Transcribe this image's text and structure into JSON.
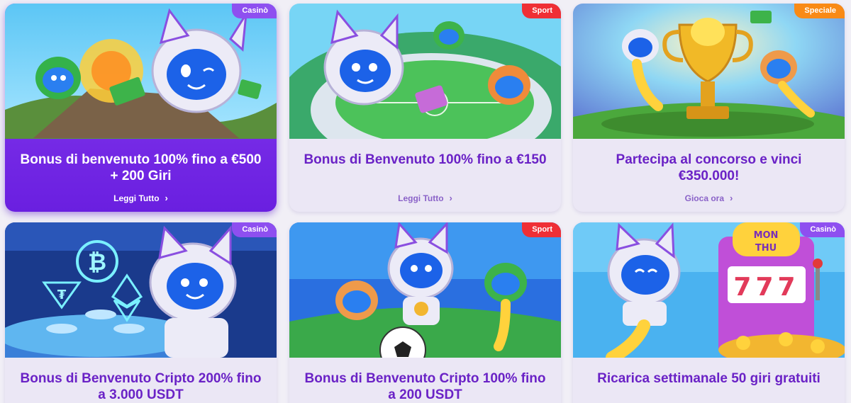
{
  "promos": [
    {
      "tag": "Casinò",
      "title": "Bonus di benvenuto 100% fino a €500 + 200 Giri",
      "link": "Leggi Tutto"
    },
    {
      "tag": "Sport",
      "title": "Bonus di Benvenuto 100% fino a €150",
      "link": "Leggi Tutto"
    },
    {
      "tag": "Speciale",
      "title": "Partecipa al concorso e vinci €350.000!",
      "link": "Gioca ora"
    },
    {
      "tag": "Casinò",
      "title": "Bonus di Benvenuto Cripto 200% fino a 3.000 USDT"
    },
    {
      "tag": "Sport",
      "title": "Bonus di Benvenuto Cripto 100% fino a 200 USDT"
    },
    {
      "tag": "Casinò",
      "title": "Ricarica settimanale 50 giri gratuiti"
    }
  ],
  "slot_sign": {
    "line1": "MON",
    "line2": "THU",
    "reels": "777"
  },
  "colors": {
    "casino_tag": "#8e4ff0",
    "sport_tag": "#ef2f35",
    "special_tag": "#f98a16",
    "title_purple": "#6a22c6",
    "active_card": "#7a2fe8"
  },
  "icons": [
    "chevron-right-icon",
    "cat-astronaut-mascot",
    "bitcoin-icon",
    "tether-icon",
    "ethereum-icon",
    "trophy-icon",
    "soccer-ball-icon",
    "slot-machine-icon"
  ]
}
